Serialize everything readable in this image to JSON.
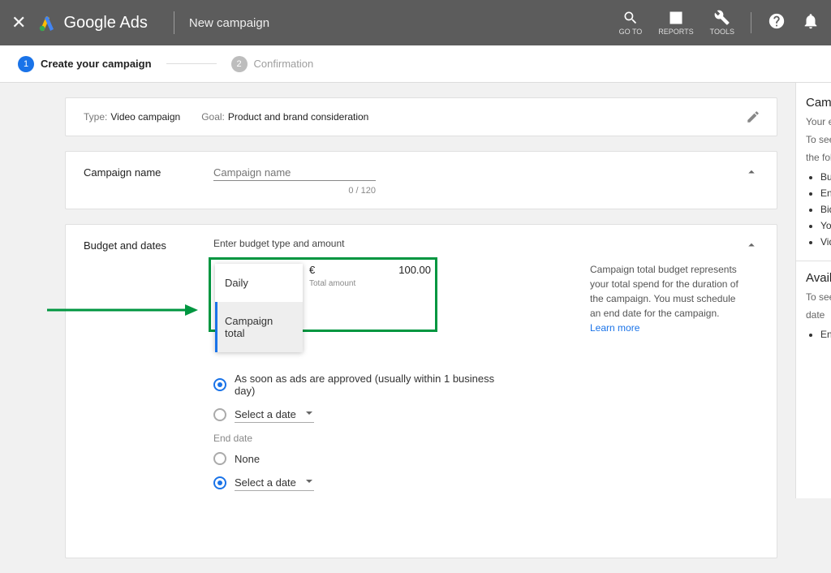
{
  "topbar": {
    "brand": "Google Ads",
    "page": "New campaign",
    "icons": {
      "goto": "GO TO",
      "reports": "REPORTS",
      "tools": "TOOLS"
    }
  },
  "stepper": {
    "step1_num": "1",
    "step1_label": "Create your campaign",
    "step2_num": "2",
    "step2_label": "Confirmation"
  },
  "meta": {
    "type_label": "Type:",
    "type_value": "Video campaign",
    "goal_label": "Goal:",
    "goal_value": "Product and brand consideration"
  },
  "name": {
    "section": "Campaign name",
    "placeholder": "Campaign name",
    "counter": "0 / 120"
  },
  "budget": {
    "section": "Budget and dates",
    "prompt": "Enter budget type and amount",
    "dd_daily": "Daily",
    "dd_total": "Campaign total",
    "currency": "€",
    "amount": "100.00",
    "amount_sub": "Total amount",
    "info": "Campaign total budget represents your total spend for the duration of the campaign. You must schedule an end date for the campaign.",
    "learn": "Learn more",
    "start_asap": "As soon as ads are approved (usually within 1 business day)",
    "select_date": "Select a date",
    "end_label": "End date",
    "none": "None"
  },
  "sidebar": {
    "h1": "Cam",
    "sub1a": "Your e",
    "sub1b": "To see",
    "sub1c": "the foll",
    "li1": "Bud",
    "li2": "End",
    "li3": "Bid",
    "li4": "You",
    "li5": "Vide",
    "h2": "Availa",
    "sub2a": "To see",
    "sub2b": "date",
    "li6": "End"
  }
}
